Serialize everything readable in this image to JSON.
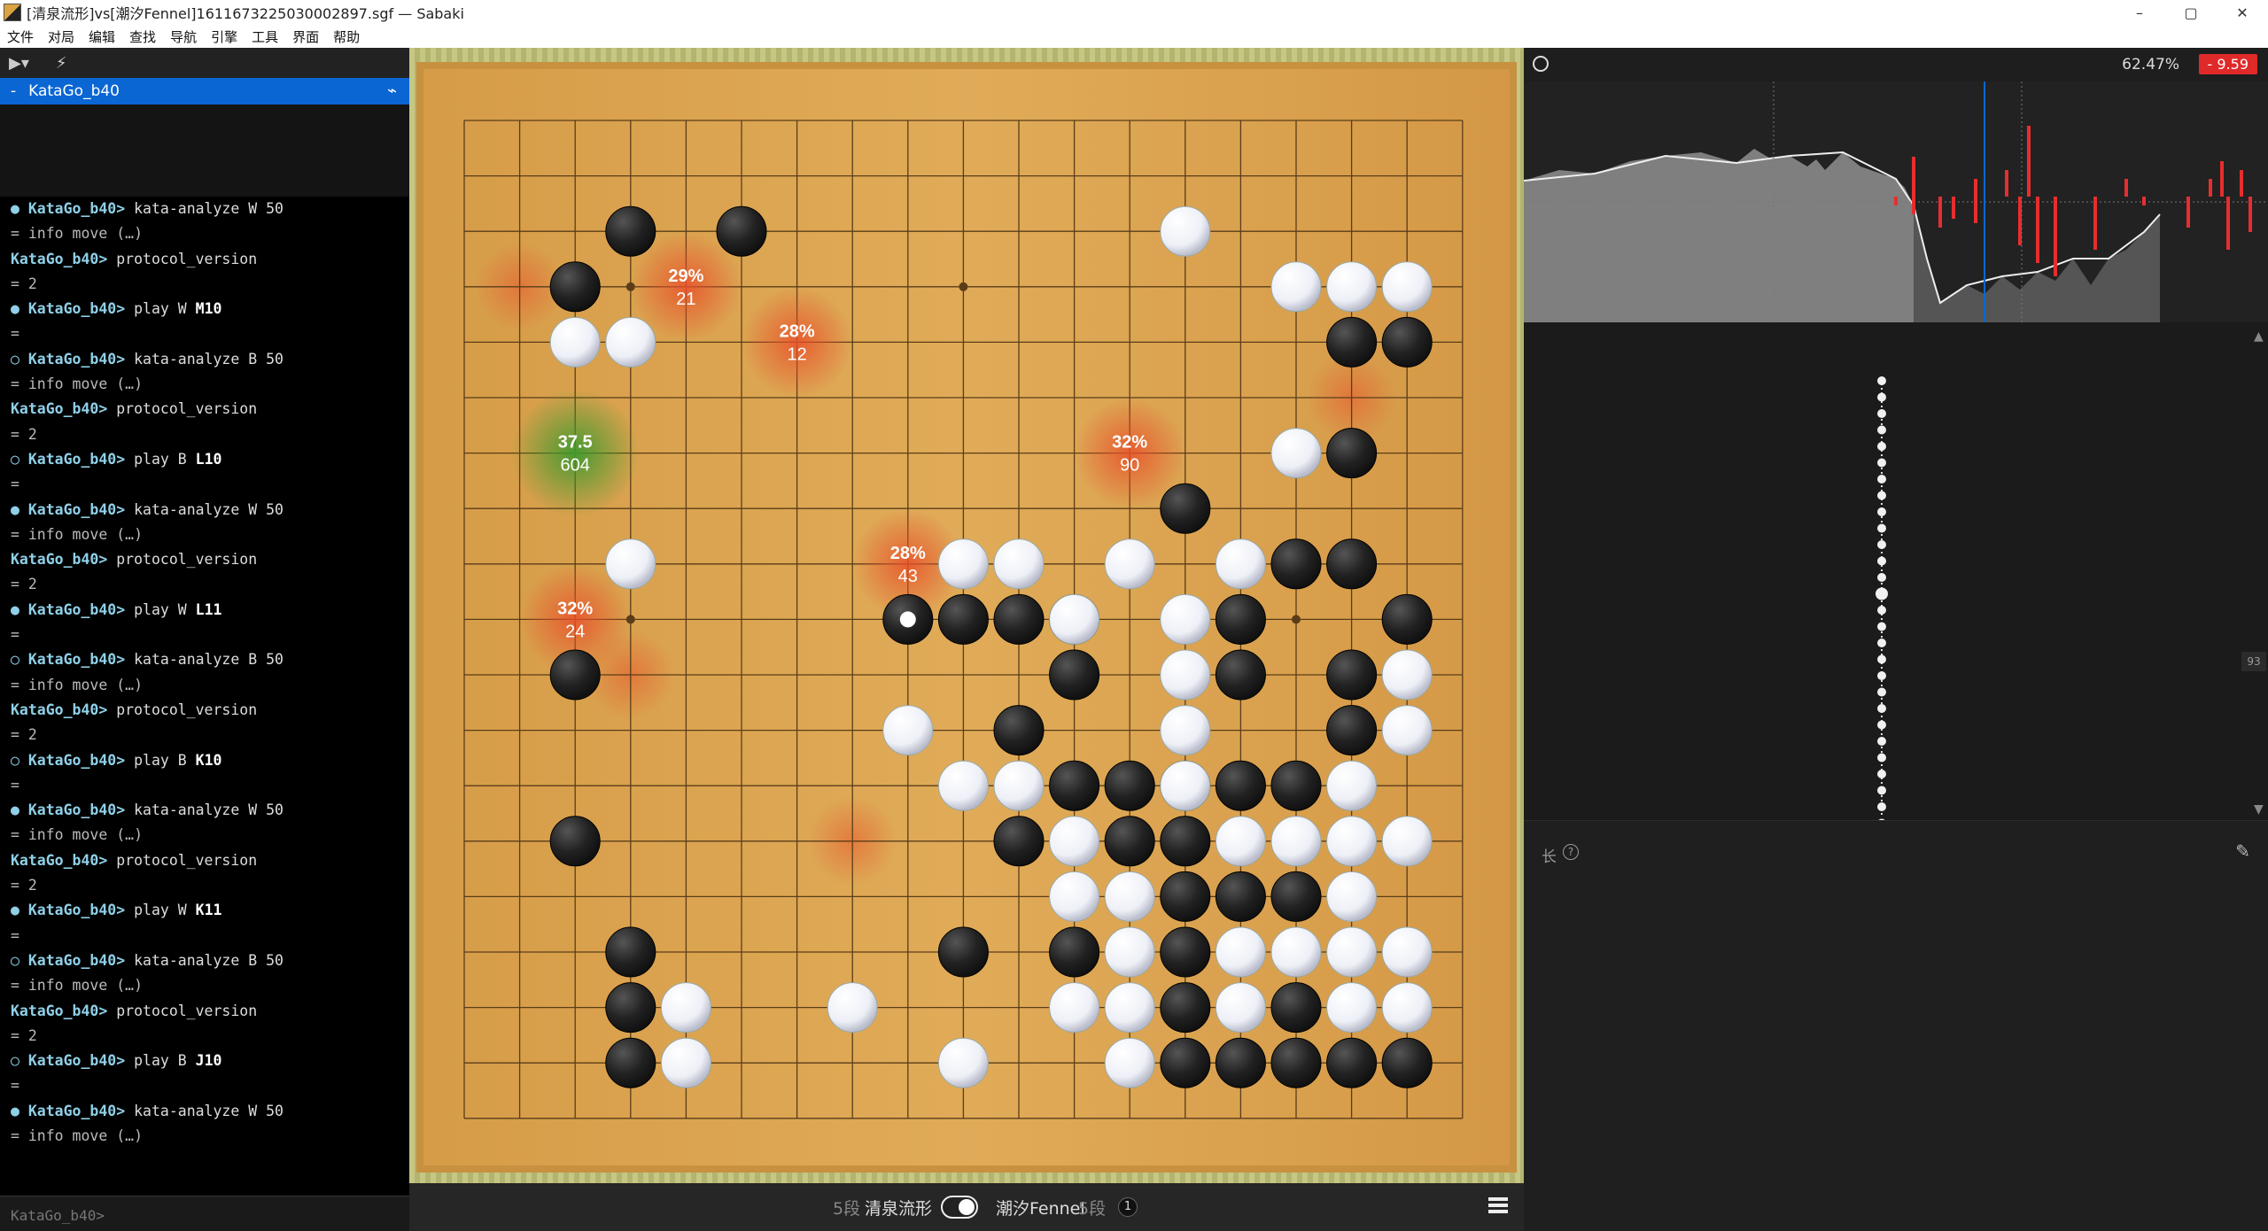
{
  "window": {
    "title": "[清泉流形]vs[潮汐Fennel]1611673225030002897.sgf — Sabaki",
    "minimize": "–",
    "maximize": "▢",
    "close": "✕"
  },
  "menu": [
    "文件",
    "对局",
    "编辑",
    "查找",
    "导航",
    "引擎",
    "工具",
    "界面",
    "帮助"
  ],
  "engine_panel": {
    "engine_name": "KataGo_b40",
    "prompt_placeholder": "KataGo_b40>",
    "console": [
      {
        "t": "cmd",
        "mark": "●",
        "eng": "KataGo_b40>",
        "text": " kata-analyze W 50"
      },
      {
        "t": "resp",
        "text": "= info move (…)"
      },
      {
        "t": "cmd",
        "mark": "",
        "eng": "KataGo_b40>",
        "text": " protocol_version"
      },
      {
        "t": "resp",
        "text": "= 2"
      },
      {
        "t": "cmd",
        "mark": "●",
        "eng": "KataGo_b40>",
        "text": " play W ",
        "arg": "M10"
      },
      {
        "t": "resp",
        "text": "="
      },
      {
        "t": "cmd",
        "mark": "○",
        "eng": "KataGo_b40>",
        "text": " kata-analyze B 50"
      },
      {
        "t": "resp",
        "text": "= info move (…)"
      },
      {
        "t": "cmd",
        "mark": "",
        "eng": "KataGo_b40>",
        "text": " protocol_version"
      },
      {
        "t": "resp",
        "text": "= 2"
      },
      {
        "t": "cmd",
        "mark": "○",
        "eng": "KataGo_b40>",
        "text": " play B ",
        "arg": "L10"
      },
      {
        "t": "resp",
        "text": "="
      },
      {
        "t": "cmd",
        "mark": "●",
        "eng": "KataGo_b40>",
        "text": " kata-analyze W 50"
      },
      {
        "t": "resp",
        "text": "= info move (…)"
      },
      {
        "t": "cmd",
        "mark": "",
        "eng": "KataGo_b40>",
        "text": " protocol_version"
      },
      {
        "t": "resp",
        "text": "= 2"
      },
      {
        "t": "cmd",
        "mark": "●",
        "eng": "KataGo_b40>",
        "text": " play W ",
        "arg": "L11"
      },
      {
        "t": "resp",
        "text": "="
      },
      {
        "t": "cmd",
        "mark": "○",
        "eng": "KataGo_b40>",
        "text": " kata-analyze B 50"
      },
      {
        "t": "resp",
        "text": "= info move (…)"
      },
      {
        "t": "cmd",
        "mark": "",
        "eng": "KataGo_b40>",
        "text": " protocol_version"
      },
      {
        "t": "resp",
        "text": "= 2"
      },
      {
        "t": "cmd",
        "mark": "○",
        "eng": "KataGo_b40>",
        "text": " play B ",
        "arg": "K10"
      },
      {
        "t": "resp",
        "text": "="
      },
      {
        "t": "cmd",
        "mark": "●",
        "eng": "KataGo_b40>",
        "text": " kata-analyze W 50"
      },
      {
        "t": "resp",
        "text": "= info move (…)"
      },
      {
        "t": "cmd",
        "mark": "",
        "eng": "KataGo_b40>",
        "text": " protocol_version"
      },
      {
        "t": "resp",
        "text": "= 2"
      },
      {
        "t": "cmd",
        "mark": "●",
        "eng": "KataGo_b40>",
        "text": " play W ",
        "arg": "K11"
      },
      {
        "t": "resp",
        "text": "="
      },
      {
        "t": "cmd",
        "mark": "○",
        "eng": "KataGo_b40>",
        "text": " kata-analyze B 50"
      },
      {
        "t": "resp",
        "text": "= info move (…)"
      },
      {
        "t": "cmd",
        "mark": "",
        "eng": "KataGo_b40>",
        "text": " protocol_version"
      },
      {
        "t": "resp",
        "text": "= 2"
      },
      {
        "t": "cmd",
        "mark": "○",
        "eng": "KataGo_b40>",
        "text": " play B ",
        "arg": "J10"
      },
      {
        "t": "resp",
        "text": "="
      },
      {
        "t": "cmd",
        "mark": "●",
        "eng": "KataGo_b40>",
        "text": " kata-analyze W 50"
      },
      {
        "t": "resp",
        "text": "= info move (…)"
      }
    ]
  },
  "board": {
    "size": 19,
    "black": [
      [
        3,
        2
      ],
      [
        5,
        2
      ],
      [
        2,
        3
      ],
      [
        16,
        4
      ],
      [
        17,
        4
      ],
      [
        16,
        6
      ],
      [
        13,
        7
      ],
      [
        15,
        8
      ],
      [
        9,
        9
      ],
      [
        10,
        9
      ],
      [
        11,
        9
      ],
      [
        14,
        9
      ],
      [
        16,
        8
      ],
      [
        17,
        9
      ],
      [
        2,
        10
      ],
      [
        11,
        10
      ],
      [
        14,
        10
      ],
      [
        16,
        10
      ],
      [
        10,
        11
      ],
      [
        16,
        11
      ],
      [
        11,
        12
      ],
      [
        12,
        12
      ],
      [
        13,
        12
      ],
      [
        14,
        12
      ],
      [
        15,
        12
      ],
      [
        10,
        13
      ],
      [
        12,
        13
      ],
      [
        13,
        13
      ],
      [
        2,
        13
      ],
      [
        13,
        14
      ],
      [
        14,
        14
      ],
      [
        15,
        14
      ],
      [
        3,
        15
      ],
      [
        9,
        15
      ],
      [
        11,
        15
      ],
      [
        13,
        15
      ],
      [
        3,
        16
      ],
      [
        13,
        16
      ],
      [
        15,
        16
      ],
      [
        3,
        17
      ],
      [
        13,
        17
      ],
      [
        14,
        17
      ],
      [
        15,
        17
      ],
      [
        16,
        17
      ],
      [
        17,
        17
      ]
    ],
    "white": [
      [
        13,
        2
      ],
      [
        15,
        3
      ],
      [
        16,
        3
      ],
      [
        17,
        3
      ],
      [
        2,
        4
      ],
      [
        3,
        4
      ],
      [
        15,
        6
      ],
      [
        3,
        8
      ],
      [
        9,
        8
      ],
      [
        10,
        8
      ],
      [
        12,
        8
      ],
      [
        14,
        8
      ],
      [
        11,
        9
      ],
      [
        13,
        9
      ],
      [
        13,
        10
      ],
      [
        17,
        10
      ],
      [
        8,
        11
      ],
      [
        13,
        11
      ],
      [
        17,
        11
      ],
      [
        9,
        12
      ],
      [
        10,
        12
      ],
      [
        13,
        12.02
      ],
      [
        16,
        12
      ],
      [
        11,
        13
      ],
      [
        14,
        13
      ],
      [
        15,
        13
      ],
      [
        16,
        13
      ],
      [
        17,
        13
      ],
      [
        11,
        14
      ],
      [
        12,
        14
      ],
      [
        16,
        14
      ],
      [
        12,
        15
      ],
      [
        14,
        15
      ],
      [
        15,
        15
      ],
      [
        16,
        15
      ],
      [
        17,
        15
      ],
      [
        4,
        16
      ],
      [
        7,
        16
      ],
      [
        11,
        16
      ],
      [
        12,
        16
      ],
      [
        14,
        16
      ],
      [
        16,
        16
      ],
      [
        17,
        16
      ],
      [
        9,
        17
      ],
      [
        12,
        17
      ],
      [
        4,
        17
      ]
    ],
    "last_move": [
      8,
      9
    ],
    "hoshi": [
      [
        3,
        3
      ],
      [
        9,
        3
      ],
      [
        15,
        3
      ],
      [
        3,
        9
      ],
      [
        9,
        9
      ],
      [
        15,
        9
      ],
      [
        3,
        15
      ],
      [
        9,
        15
      ],
      [
        15,
        15
      ]
    ],
    "analysis": [
      {
        "pos": [
          4,
          3
        ],
        "line1": "29%",
        "line2": "21"
      },
      {
        "pos": [
          6,
          4
        ],
        "line1": "28%",
        "line2": "12"
      },
      {
        "pos": [
          2,
          6
        ],
        "line1": "37.5",
        "line2": "604",
        "best": true
      },
      {
        "pos": [
          12,
          6
        ],
        "line1": "32%",
        "line2": "90"
      },
      {
        "pos": [
          8,
          8
        ],
        "line1": "28%",
        "line2": "43"
      },
      {
        "pos": [
          2,
          9
        ],
        "line1": "32%",
        "line2": "24"
      }
    ]
  },
  "players": {
    "black_rank": "5段",
    "black_name": "清泉流形",
    "white_name": "潮汐Fennel",
    "white_rank": "5段",
    "white_captures": "1"
  },
  "right_panel": {
    "winrate": "62.47%",
    "score": "- 9.59",
    "move_number": "93",
    "comment_label": "长",
    "help_icon": "?"
  },
  "colors": {
    "board": "#dca44f",
    "best_hint": "#4aa33a",
    "hint": "#e45a2a",
    "accent": "#0a66d2",
    "score_red": "#e02929"
  }
}
